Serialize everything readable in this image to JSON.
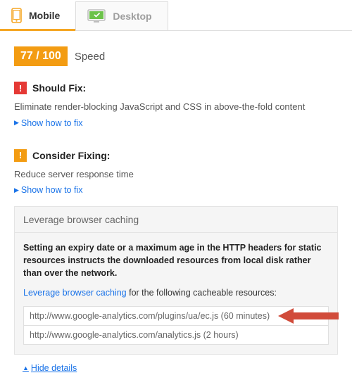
{
  "tabs": {
    "mobile": {
      "label": "Mobile"
    },
    "desktop": {
      "label": "Desktop"
    }
  },
  "score": {
    "badge": "77 / 100",
    "label": "Speed"
  },
  "should_fix": {
    "heading": "Should Fix:",
    "rule": "Eliminate render-blocking JavaScript and CSS in above-the-fold content",
    "show_link": "Show how to fix"
  },
  "consider_fixing": {
    "heading": "Consider Fixing:",
    "rule": "Reduce server response time",
    "show_link": "Show how to fix"
  },
  "expanded": {
    "title": "Leverage browser caching",
    "desc": "Setting an expiry date or a maximum age in the HTTP headers for static resources instructs the downloaded resources from local disk rather than over the network.",
    "link_text": "Leverage browser caching",
    "sub_text": " for the following cacheable resources:",
    "resources": [
      "http://www.google-analytics.com/plugins/ua/ec.js (60 minutes)",
      "http://www.google-analytics.com/analytics.js (2 hours)"
    ],
    "hide_link": "Hide details"
  }
}
